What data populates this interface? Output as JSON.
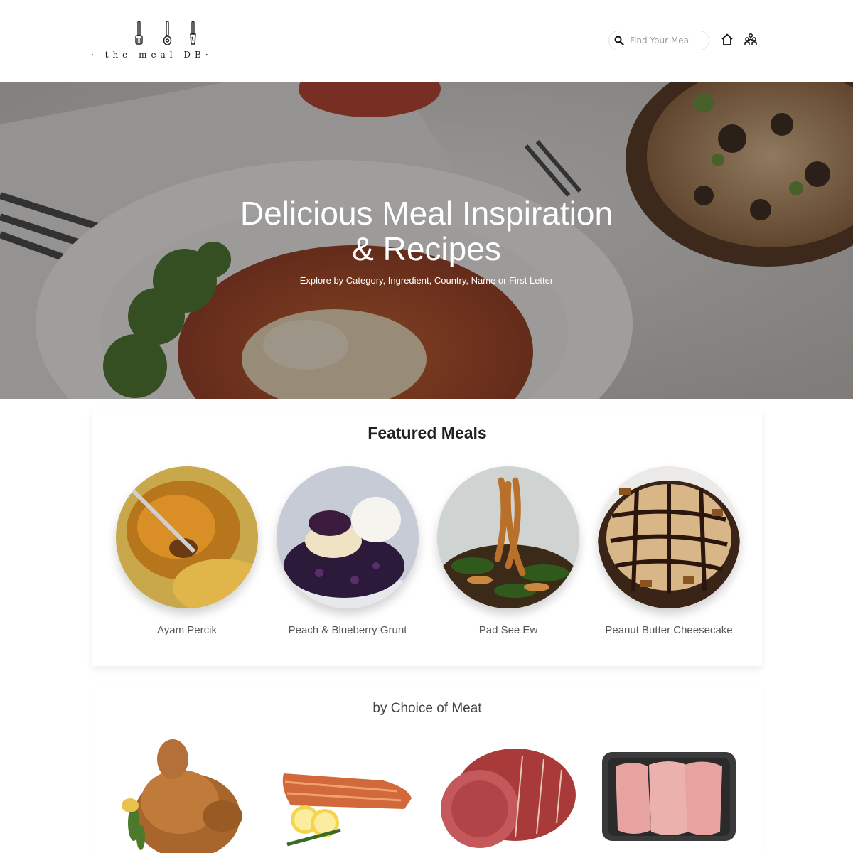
{
  "header": {
    "logo_text": "· the  meal  DB·",
    "search_placeholder": "Find Your Meal",
    "icons": [
      "search-icon",
      "home-icon",
      "users-icon"
    ]
  },
  "hero": {
    "title_line1": "Delicious Meal Inspiration",
    "title_line2": "& Recipes",
    "subtitle": "Explore by Category, Ingredient, Country, Name or First Letter"
  },
  "featured": {
    "title": "Featured Meals",
    "meals": [
      {
        "name": "Ayam Percik"
      },
      {
        "name": "Peach & Blueberry Grunt"
      },
      {
        "name": "Pad See Ew"
      },
      {
        "name": "Peanut Butter Cheesecake"
      }
    ]
  },
  "meat": {
    "title": "by Choice of Meat",
    "items": [
      "chicken",
      "salmon",
      "beef",
      "pork"
    ]
  }
}
